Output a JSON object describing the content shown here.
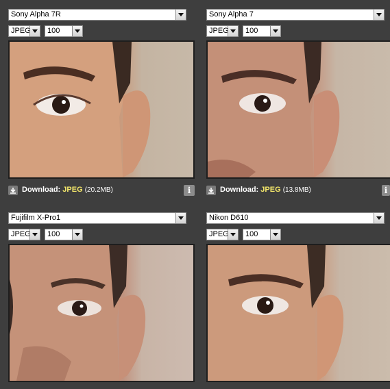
{
  "panels": [
    {
      "camera": "Sony Alpha 7R",
      "format": "JPEG",
      "quality": "100",
      "download": {
        "label": "Download:",
        "format": "JPEG",
        "size": "(20.2MB)"
      },
      "info": "i",
      "photo_icon": "face-crop-photo"
    },
    {
      "camera": "Sony Alpha 7",
      "format": "JPEG",
      "quality": "100",
      "download": {
        "label": "Download:",
        "format": "JPEG",
        "size": "(13.8MB)"
      },
      "info": "i",
      "photo_icon": "face-crop-photo"
    },
    {
      "camera": "Fujifilm X-Pro1",
      "format": "JPEG",
      "quality": "100",
      "photo_icon": "face-crop-photo"
    },
    {
      "camera": "Nikon D610",
      "format": "JPEG",
      "quality": "100",
      "photo_icon": "face-crop-photo"
    }
  ],
  "colors": {
    "background": "#3e3e3e",
    "download_format": "#f4e76a",
    "skin": "#c99878",
    "wall": "#c9baa8"
  },
  "icons": {
    "download": "download-arrow-icon",
    "info": "info-icon",
    "dropdown": "chevron-down-icon"
  }
}
